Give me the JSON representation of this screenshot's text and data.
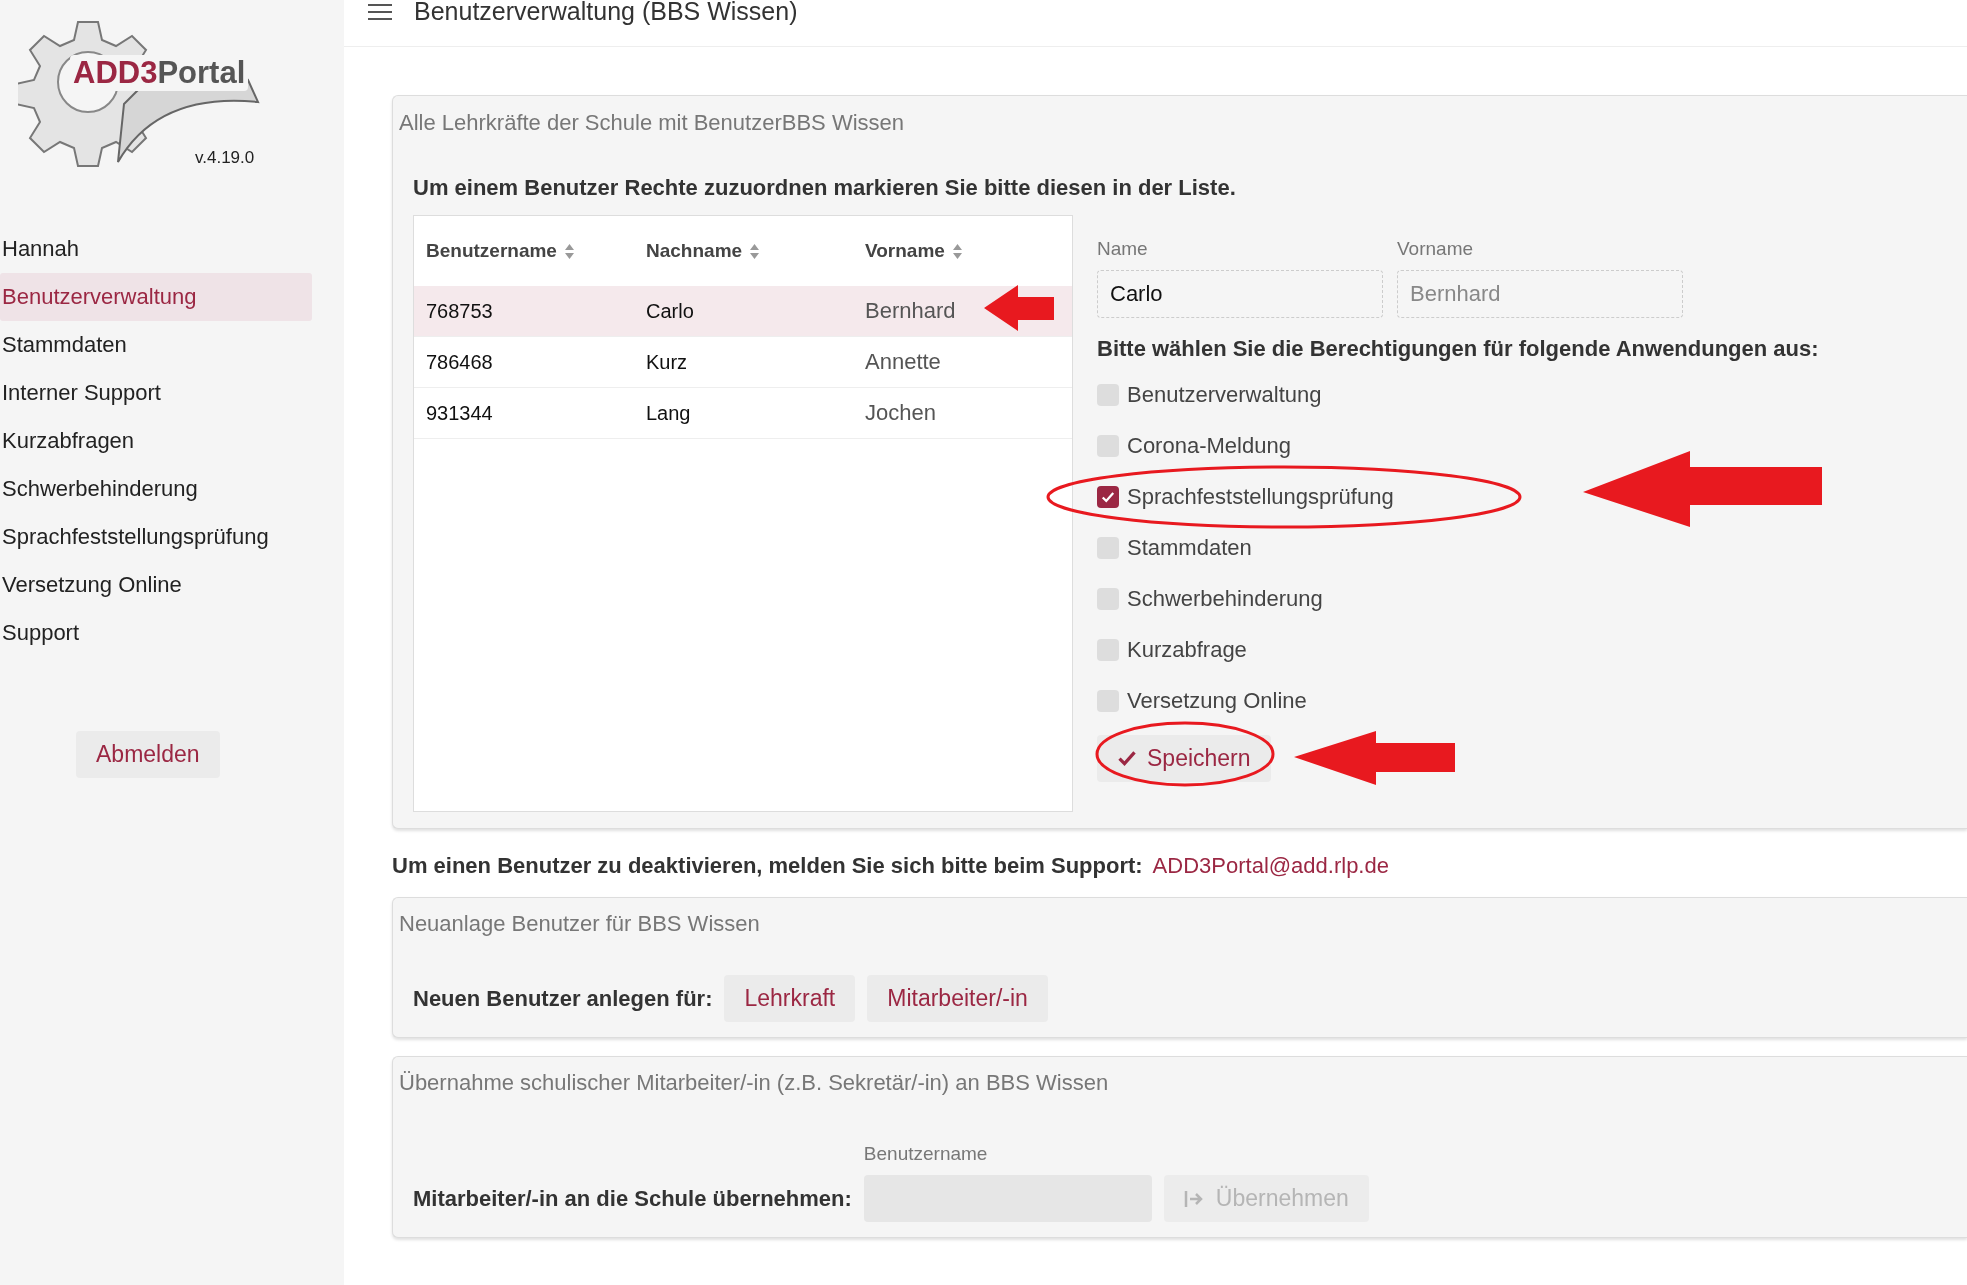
{
  "logo": {
    "part_a": "ADD3",
    "part_b": "Portal",
    "version": "v.4.19.0"
  },
  "sidebar": {
    "items": [
      {
        "label": "Hannah",
        "selected": false
      },
      {
        "label": "Benutzerverwaltung",
        "selected": true
      },
      {
        "label": "Stammdaten",
        "selected": false
      },
      {
        "label": "Interner Support",
        "selected": false
      },
      {
        "label": "Kurzabfragen",
        "selected": false
      },
      {
        "label": "Schwerbehinderung",
        "selected": false
      },
      {
        "label": "Sprachfeststellungsprüfung",
        "selected": false
      },
      {
        "label": "Versetzung Online",
        "selected": false
      },
      {
        "label": "Support",
        "selected": false
      }
    ],
    "logout": "Abmelden"
  },
  "header": {
    "title": "Benutzerverwaltung (BBS Wissen)"
  },
  "users_panel": {
    "title": "Alle Lehrkräfte der Schule mit BenutzerBBS Wissen",
    "instruction": "Um einem Benutzer Rechte zuzuordnen markieren Sie bitte diesen in der Liste.",
    "table": {
      "columns": [
        "Benutzername",
        "Nachname",
        "Vorname"
      ],
      "rows": [
        {
          "cells": [
            "768753",
            "Carlo",
            "Bernhard"
          ],
          "selected": true
        },
        {
          "cells": [
            "786468",
            "Kurz",
            "Annette"
          ],
          "selected": false
        },
        {
          "cells": [
            "931344",
            "Lang",
            "Jochen"
          ],
          "selected": false
        }
      ]
    },
    "fields": [
      {
        "label": "Name",
        "value": "Carlo",
        "disabled": false
      },
      {
        "label": "Vorname",
        "value": "Bernhard",
        "disabled": true
      }
    ],
    "permissions_title": "Bitte wählen Sie die Berechtigungen für folgende Anwendungen aus:",
    "permissions": [
      {
        "label": "Benutzerverwaltung",
        "checked": false
      },
      {
        "label": "Corona-Meldung",
        "checked": false
      },
      {
        "label": "Sprachfeststellungsprüfung",
        "checked": true
      },
      {
        "label": "Stammdaten",
        "checked": false
      },
      {
        "label": "Schwerbehinderung",
        "checked": false
      },
      {
        "label": "Kurzabfrage",
        "checked": false
      },
      {
        "label": "Versetzung Online",
        "checked": false
      }
    ],
    "save_button": "Speichern"
  },
  "deactivate_note": {
    "text": "Um einen Benutzer zu deaktivieren, melden Sie sich bitte beim Support:",
    "link": "ADD3Portal@add.rlp.de"
  },
  "new_user_panel": {
    "title": "Neuanlage Benutzer für BBS Wissen",
    "label": "Neuen Benutzer anlegen für:",
    "buttons": [
      "Lehrkraft",
      "Mitarbeiter/-in"
    ]
  },
  "transfer_panel": {
    "title": "Übernahme schulischer Mitarbeiter/-in (z.B. Sekretär/-in) an BBS Wissen",
    "field_label": "Benutzername",
    "label": "Mitarbeiter/-in an die Schule übernehmen:",
    "button": "Übernehmen",
    "button_disabled": true
  }
}
